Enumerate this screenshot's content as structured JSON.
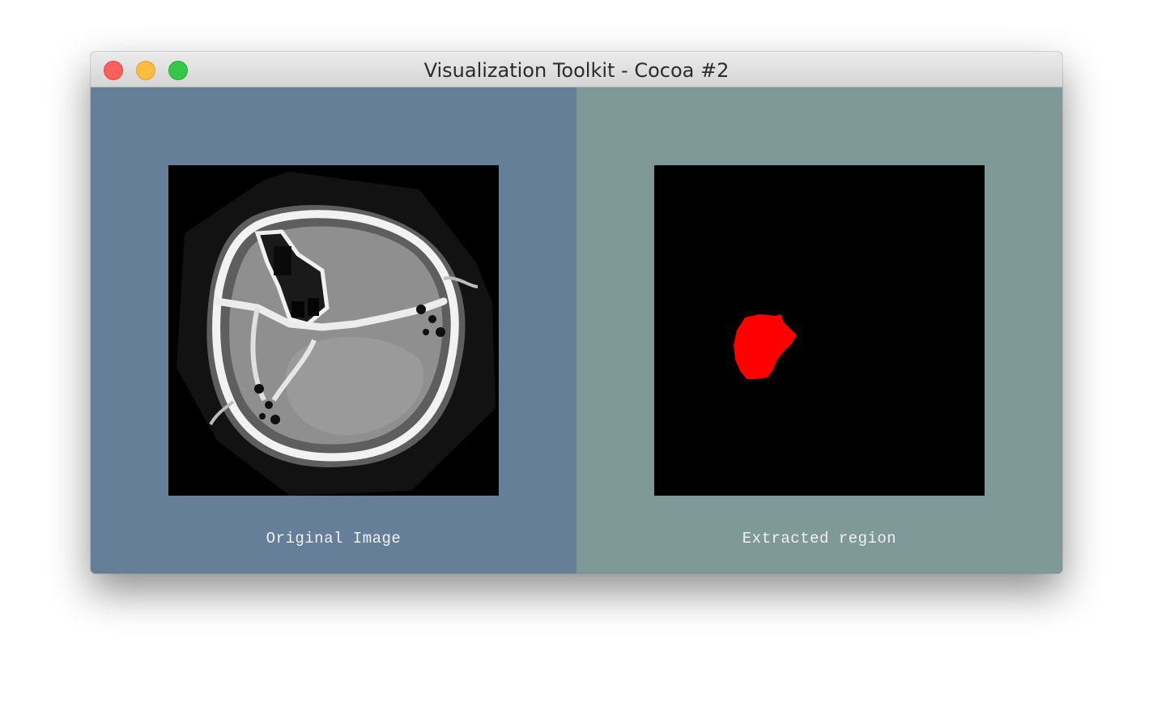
{
  "window": {
    "title": "Visualization Toolkit - Cocoa #2",
    "buttons": [
      "close-icon",
      "minimize-icon",
      "zoom-icon"
    ]
  },
  "viewports": [
    {
      "caption": "Original Image",
      "background": "#667f99"
    },
    {
      "caption": "Extracted region",
      "background": "#7f9999",
      "region_color": "#ff0000"
    }
  ]
}
